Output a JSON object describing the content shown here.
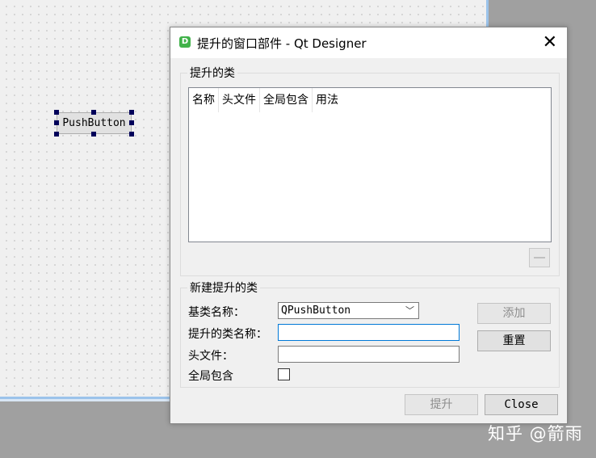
{
  "canvas": {
    "widget_label": "PushButton"
  },
  "dialog": {
    "icon_letter": "D",
    "title": "提升的窗口部件 - Qt Designer",
    "close_glyph": "✕",
    "promoted_group": {
      "title": "提升的类",
      "columns": [
        "名称",
        "头文件",
        "全局包含",
        "用法"
      ]
    },
    "new_group": {
      "title": "新建提升的类",
      "base_label": "基类名称：",
      "base_value": "QPushButton",
      "promoted_label": "提升的类名称：",
      "promoted_value": "",
      "header_label": "头文件：",
      "header_value": "",
      "global_label": "全局包含",
      "add_button": "添加",
      "reset_button": "重置"
    },
    "promote_button": "提升",
    "close_button": "Close"
  },
  "watermark": "知乎 @箭雨",
  "icons": {
    "app": "designer-app-icon",
    "close": "close-icon",
    "dropdown": "chevron-down-icon",
    "remove": "minus-icon"
  }
}
